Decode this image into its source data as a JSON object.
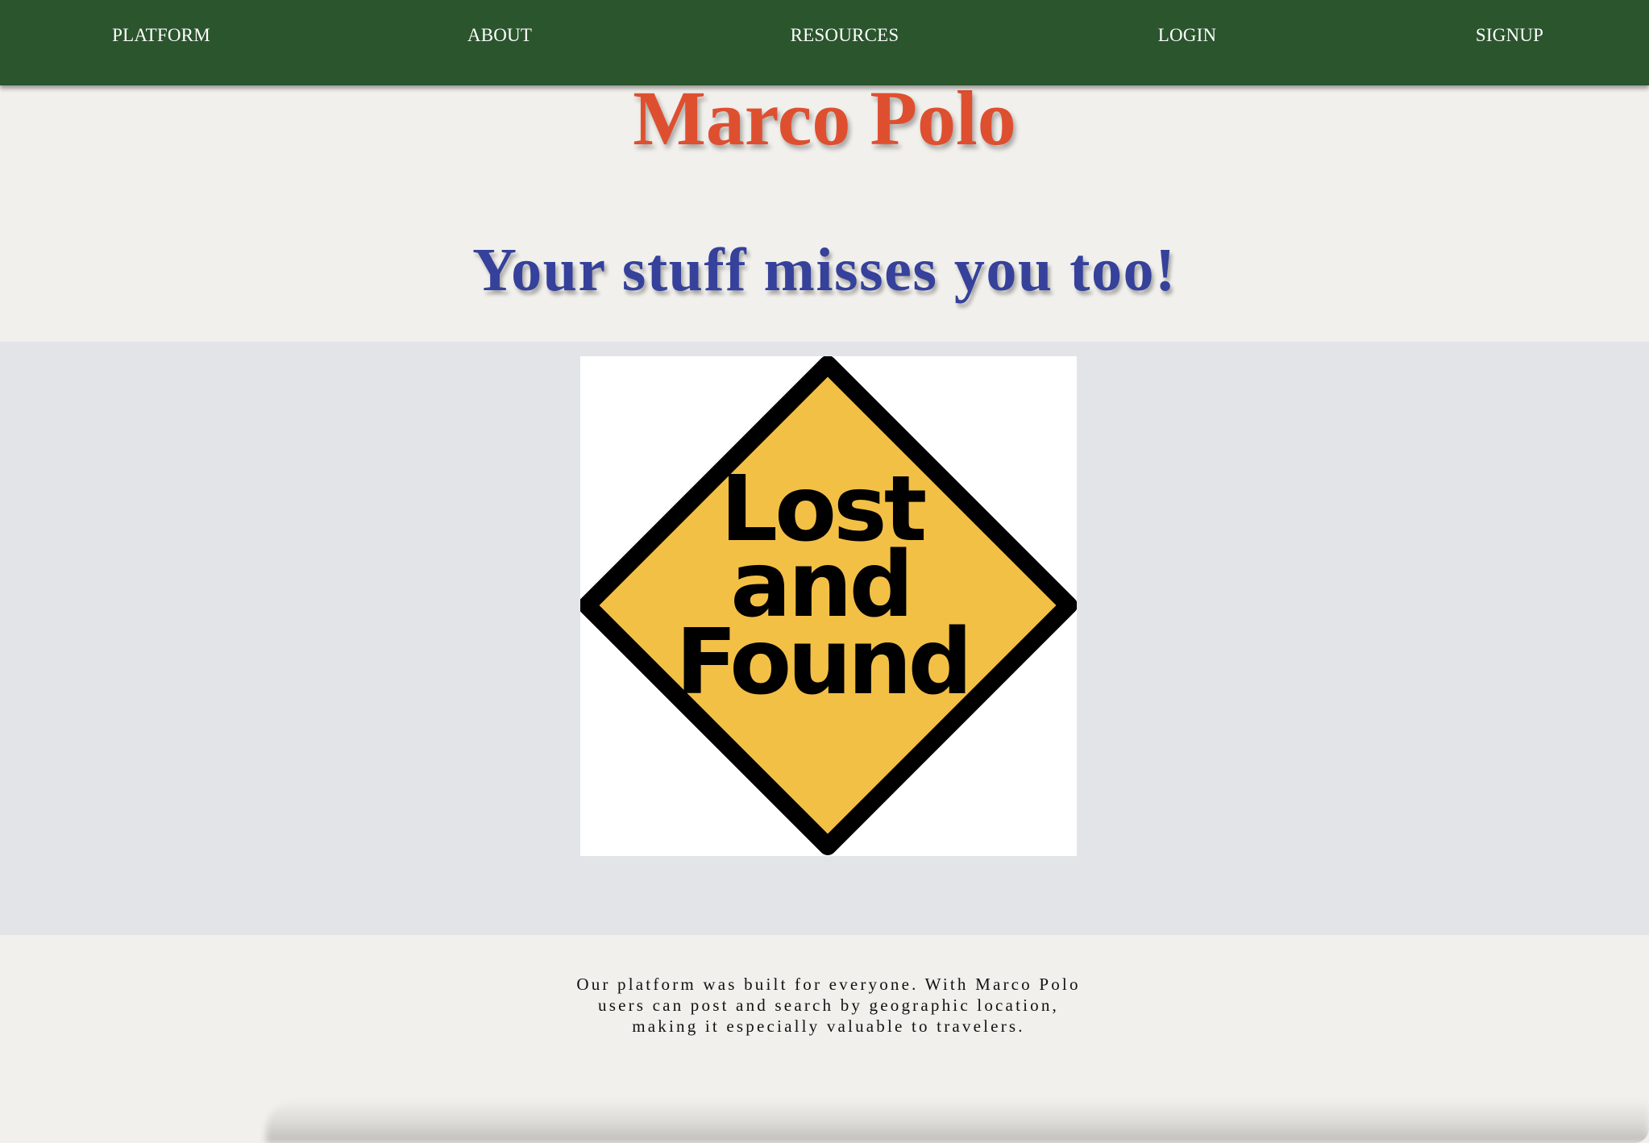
{
  "nav": {
    "items": [
      {
        "label": "PLATFORM"
      },
      {
        "label": "ABOUT"
      },
      {
        "label": "RESOURCES"
      },
      {
        "label": "LOGIN"
      },
      {
        "label": "SIGNUP"
      }
    ]
  },
  "header": {
    "brand": "Marco Polo",
    "tagline": "Your stuff misses you too!"
  },
  "hero": {
    "sign_lines": [
      "Lost",
      "and",
      "Found"
    ]
  },
  "description": "Our platform was built for everyone. With Marco Polo users can post and search by geographic location, making it especially valuable to travelers.",
  "colors": {
    "nav_background": "#2b552d",
    "brand": "#de4f30",
    "tagline": "#35419a",
    "page_background": "#f1f0ec",
    "hero_band": "#e3e4e8",
    "sign_fill": "#f3c046",
    "sign_border": "#000000"
  }
}
